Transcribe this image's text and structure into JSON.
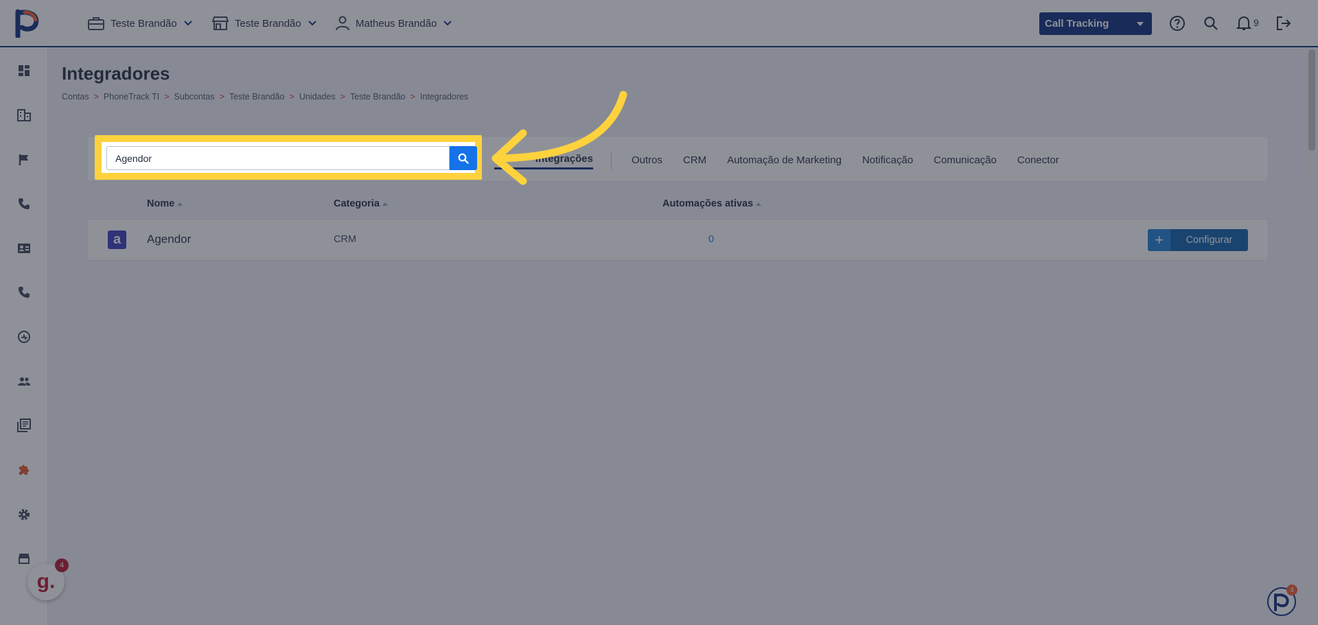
{
  "header": {
    "context": [
      {
        "label": "Teste Brandão",
        "icon": "briefcase-icon"
      },
      {
        "label": "Teste Brandão",
        "icon": "store-icon"
      },
      {
        "label": "Matheus Brandão",
        "icon": "user-icon"
      }
    ],
    "product_select": "Call Tracking",
    "notifications_count": "9"
  },
  "sidebar": {
    "items": [
      {
        "icon": "dashboard-icon"
      },
      {
        "icon": "building-icon"
      },
      {
        "icon": "flag-icon"
      },
      {
        "icon": "phone-icon"
      },
      {
        "icon": "contact-card-icon"
      },
      {
        "icon": "phone-call-icon"
      },
      {
        "icon": "speed-icon"
      },
      {
        "icon": "people-icon"
      },
      {
        "icon": "library-icon"
      },
      {
        "icon": "puzzle-icon",
        "active": true
      },
      {
        "icon": "gear-icon"
      },
      {
        "icon": "store-icon"
      }
    ],
    "active_color": "#e0562a"
  },
  "page": {
    "title": "Integradores",
    "breadcrumb": [
      "Contas",
      "PhoneTrack TI",
      "Subcontas",
      "Teste Brandão",
      "Unidades",
      "Teste Brandão",
      "Integradores"
    ]
  },
  "filters": {
    "search_value": "Agendor",
    "tabs": [
      {
        "label": "Integrações",
        "active": true
      },
      {
        "label": "Outros"
      },
      {
        "label": "CRM"
      },
      {
        "label": "Automação de Marketing"
      },
      {
        "label": "Notificação"
      },
      {
        "label": "Comunicação"
      },
      {
        "label": "Conector"
      }
    ]
  },
  "table": {
    "columns": [
      "Nome",
      "Categoria",
      "Automações ativas"
    ],
    "rows": [
      {
        "logo_letter": "a",
        "name": "Agendor",
        "category": "CRM",
        "active_automations": "0",
        "action": "Configurar"
      }
    ]
  },
  "badges": {
    "g_letter": "g.",
    "g_count": "4",
    "p_count": "4"
  },
  "colors": {
    "primary": "#0a2a7a",
    "accent_blue": "#1572e8",
    "highlight": "#fdd23d"
  }
}
